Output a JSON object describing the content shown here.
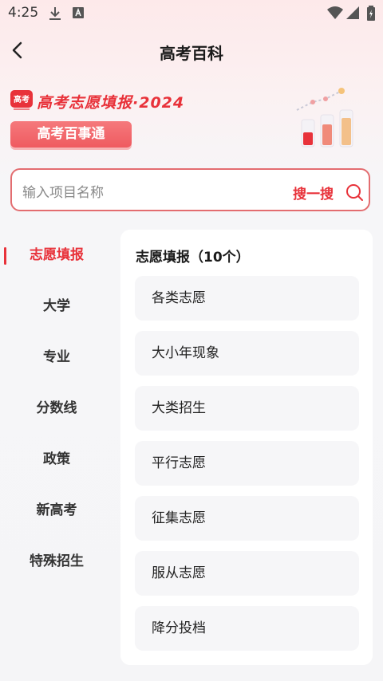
{
  "status_bar": {
    "time": "4:25"
  },
  "nav": {
    "title": "高考百科"
  },
  "banner": {
    "logo_text": "高考",
    "title": "高考志愿填报·2024",
    "button": "高考百事通"
  },
  "search": {
    "placeholder": "输入项目名称",
    "action": "搜一搜"
  },
  "sidebar": {
    "items": [
      {
        "label": "志愿填报"
      },
      {
        "label": "大学"
      },
      {
        "label": "专业"
      },
      {
        "label": "分数线"
      },
      {
        "label": "政策"
      },
      {
        "label": "新高考"
      },
      {
        "label": "特殊招生"
      }
    ],
    "active_index": 0
  },
  "panel": {
    "title": "志愿填报（10个）",
    "items": [
      {
        "label": "各类志愿"
      },
      {
        "label": "大小年现象"
      },
      {
        "label": "大类招生"
      },
      {
        "label": "平行志愿"
      },
      {
        "label": "征集志愿"
      },
      {
        "label": "服从志愿"
      },
      {
        "label": "降分投档"
      }
    ]
  },
  "colors": {
    "accent": "#e8323a",
    "button": "#ef5a60",
    "border": "#e36d70"
  }
}
